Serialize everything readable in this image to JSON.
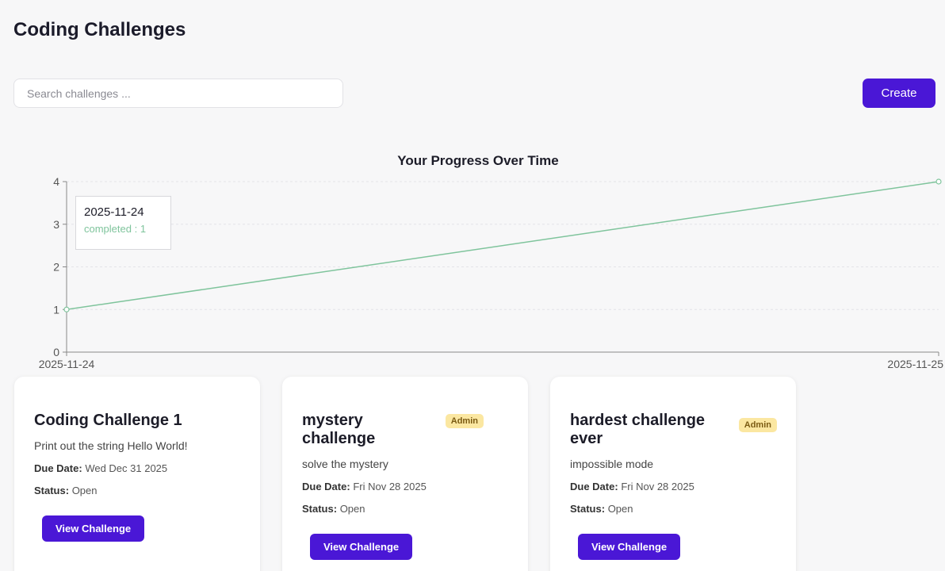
{
  "header": {
    "title": "Coding Challenges"
  },
  "search": {
    "placeholder": "Search challenges ..."
  },
  "toolbar": {
    "create_label": "Create"
  },
  "colors": {
    "accent": "#4a17d6",
    "line": "#7fc49c",
    "badge": "#fbe7a1"
  },
  "chart_data": {
    "type": "line",
    "title": "Your Progress Over Time",
    "x": [
      "2025-11-24",
      "2025-11-25"
    ],
    "series": [
      {
        "values": [
          1,
          4
        ]
      }
    ],
    "ylim": [
      0,
      4
    ],
    "yticks": [
      0,
      1,
      2,
      3,
      4
    ],
    "xlabel": "",
    "ylabel": "",
    "grid": "horizontal dashed",
    "tooltip": {
      "date": "2025-11-24",
      "text": "completed : 1"
    }
  },
  "cards": [
    {
      "title": "Coding Challenge 1",
      "badge": "",
      "description": "Print out the string Hello World!",
      "due_label": "Due Date:",
      "due_value": "Wed Dec 31 2025",
      "status_label": "Status:",
      "status_value": "Open",
      "button_label": "View Challenge"
    },
    {
      "title": "mystery challenge",
      "badge": "Admin",
      "description": "solve the mystery",
      "due_label": "Due Date:",
      "due_value": "Fri Nov 28 2025",
      "status_label": "Status:",
      "status_value": "Open",
      "button_label": "View Challenge"
    },
    {
      "title": "hardest challenge ever",
      "badge": "Admin",
      "description": "impossible mode",
      "due_label": "Due Date:",
      "due_value": "Fri Nov 28 2025",
      "status_label": "Status:",
      "status_value": "Open",
      "button_label": "View Challenge"
    }
  ]
}
